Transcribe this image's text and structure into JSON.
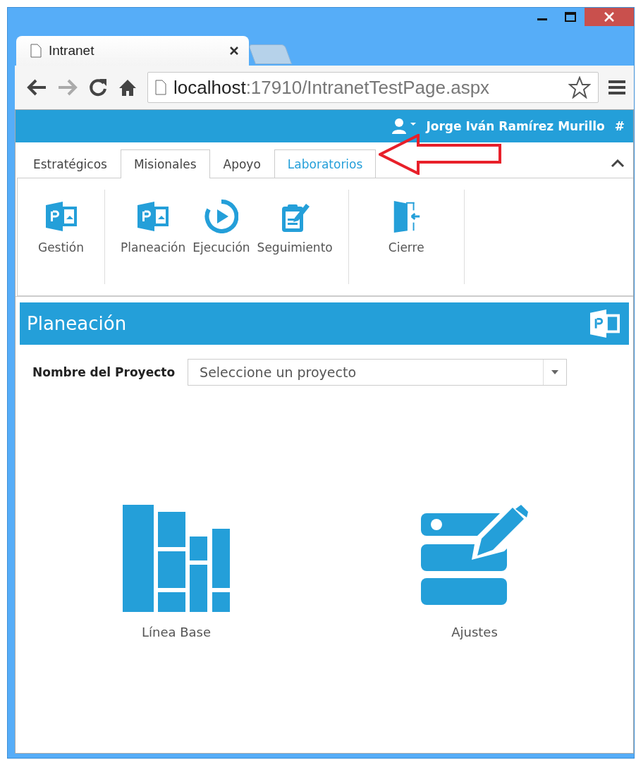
{
  "browser": {
    "tab_title": "Intranet",
    "address": {
      "host": "localhost",
      "path": ":17910/IntranetTestPage.aspx"
    }
  },
  "header": {
    "user_name": "Jorge Iván Ramírez Murillo",
    "hash_link": "#"
  },
  "tabs": [
    {
      "label": "Estratégicos",
      "selected": false,
      "highlighted": false
    },
    {
      "label": "Misionales",
      "selected": true,
      "highlighted": false
    },
    {
      "label": "Apoyo",
      "selected": false,
      "highlighted": false
    },
    {
      "label": "Laboratorios",
      "selected": false,
      "highlighted": true
    }
  ],
  "ribbon_groups": [
    {
      "items": [
        {
          "label": "Gestión",
          "kind": "project"
        }
      ]
    },
    {
      "items": [
        {
          "label": "Planeación",
          "kind": "project"
        },
        {
          "label": "Ejecución",
          "kind": "play"
        },
        {
          "label": "Seguimiento",
          "kind": "edit"
        }
      ]
    },
    {
      "items": [
        {
          "label": "Cierre",
          "kind": "door"
        }
      ]
    }
  ],
  "panel": {
    "title": "Planeación",
    "field_label": "Nombre del Proyecto",
    "select_placeholder": "Seleccione un proyecto"
  },
  "tiles": [
    {
      "label": "Línea Base",
      "kind": "books"
    },
    {
      "label": "Ajustes",
      "kind": "server-edit"
    }
  ]
}
